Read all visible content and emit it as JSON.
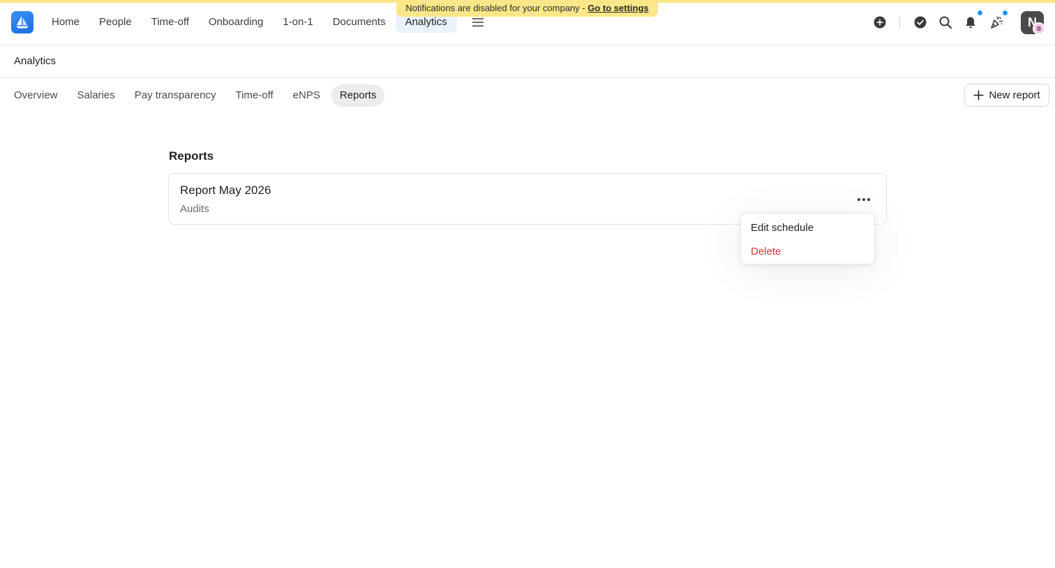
{
  "banner": {
    "text": "Notifications are disabled for your company - ",
    "link": "Go to settings"
  },
  "nav": {
    "items": [
      {
        "label": "Home"
      },
      {
        "label": "People"
      },
      {
        "label": "Time-off"
      },
      {
        "label": "Onboarding"
      },
      {
        "label": "1-on-1"
      },
      {
        "label": "Documents"
      },
      {
        "label": "Analytics",
        "active": true
      }
    ],
    "menu_icon": "hamburger-menu-icon",
    "right_icons": [
      "plus-circle-icon",
      "check-circle-icon",
      "search-icon",
      "bell-icon",
      "party-popper-icon"
    ],
    "notification_dot_color": "#2196f3",
    "avatar": {
      "initial": "N",
      "badge": "B"
    }
  },
  "page": {
    "title": "Analytics"
  },
  "subtabs": [
    {
      "label": "Overview"
    },
    {
      "label": "Salaries"
    },
    {
      "label": "Pay transparency"
    },
    {
      "label": "Time-off"
    },
    {
      "label": "eNPS"
    },
    {
      "label": "Reports",
      "active": true
    }
  ],
  "new_report_button": {
    "label": "New report",
    "icon": "plus-icon"
  },
  "reports_section": {
    "title": "Reports",
    "items": [
      {
        "name": "Report May 2026",
        "subtitle": "Audits"
      }
    ]
  },
  "context_menu": {
    "items": [
      {
        "label": "Edit schedule"
      },
      {
        "label": "Delete",
        "danger": true
      }
    ],
    "danger_color": "#e0333b"
  },
  "colors": {
    "banner": "#fbe78a",
    "active_nav_bg": "#eaf3fd",
    "active_tab_bg": "#ececec",
    "brand": "#1c6fe0"
  }
}
